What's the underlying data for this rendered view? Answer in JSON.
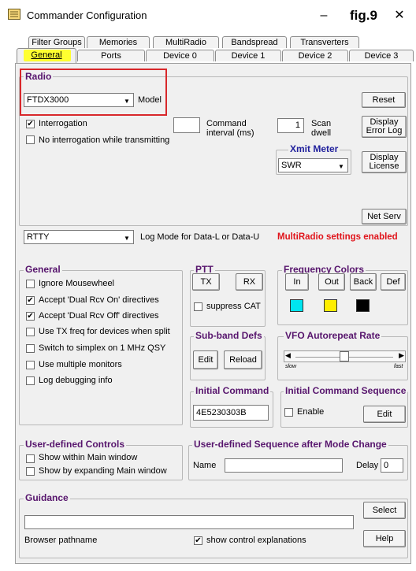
{
  "window": {
    "title": "Commander Configuration",
    "fig_label": "fig.9",
    "minimize": "–",
    "close": "✕"
  },
  "tabs_back": [
    "Filter Groups",
    "Memories",
    "MultiRadio",
    "Bandspread",
    "Transverters"
  ],
  "tabs_front": [
    "General",
    "Ports",
    "Device 0",
    "Device 1",
    "Device 2",
    "Device 3"
  ],
  "radio": {
    "title": "Radio",
    "model_value": "FTDX3000",
    "model_label": "Model",
    "reset": "Reset",
    "interrogation": "Interrogation",
    "no_interrogation": "No interrogation while transmitting",
    "command_interval_value": "",
    "command_interval_label1": "Command",
    "command_interval_label2": "interval (ms)",
    "scan_dwell_value": "1",
    "scan_dwell_label1": "Scan",
    "scan_dwell_label2": "dwell",
    "display_error_log1": "Display",
    "display_error_log2": "Error Log",
    "xmit_meter_title": "Xmit Meter",
    "xmit_meter_value": "SWR",
    "display_license1": "Display",
    "display_license2": "License",
    "net_serv": "Net Serv",
    "log_mode_value": "RTTY",
    "log_mode_label": "Log Mode for Data-L or Data-U",
    "multiradio_status": "MultiRadio settings enabled"
  },
  "general": {
    "title": "General",
    "items": [
      {
        "label": "Ignore Mousewheel",
        "checked": ""
      },
      {
        "label": "Accept 'Dual Rcv On' directives",
        "checked": "✔"
      },
      {
        "label": "Accept 'Dual Rcv Off' directives",
        "checked": "✔"
      },
      {
        "label": "Use TX freq for devices when split",
        "checked": ""
      },
      {
        "label": "Switch to simplex on 1 MHz QSY",
        "checked": ""
      },
      {
        "label": "Use multiple monitors",
        "checked": ""
      },
      {
        "label": "Log debugging info",
        "checked": ""
      }
    ]
  },
  "ptt": {
    "title": "PTT",
    "tx": "TX",
    "rx": "RX",
    "suppress_cat": "suppress CAT"
  },
  "frequency_colors": {
    "title": "Frequency Colors",
    "in": "In",
    "out": "Out",
    "back": "Back",
    "def": "Def",
    "colors": [
      "#00e5f0",
      "#ffee00",
      "#000000"
    ]
  },
  "subband": {
    "title": "Sub-band Defs",
    "edit": "Edit",
    "reload": "Reload"
  },
  "vfo": {
    "title": "VFO Autorepeat Rate",
    "slow": "slow",
    "fast": "fast",
    "level": 0.5
  },
  "initial_command": {
    "title": "Initial Command",
    "value": "4E5230303B"
  },
  "initial_sequence": {
    "title": "Initial Command Sequence",
    "enable": "Enable",
    "edit": "Edit"
  },
  "user_controls": {
    "title": "User-defined Controls",
    "within": "Show within Main window",
    "expanding": "Show by expanding Main window"
  },
  "user_sequence": {
    "title": "User-defined Sequence after Mode Change",
    "name_label": "Name",
    "name_value": "",
    "delay_label": "Delay",
    "delay_value": "0"
  },
  "guidance": {
    "title": "Guidance",
    "select": "Select",
    "path_value": "",
    "browser_label": "Browser pathname",
    "show_explanations": "show control explanations",
    "show_checked": "✔",
    "help": "Help"
  }
}
